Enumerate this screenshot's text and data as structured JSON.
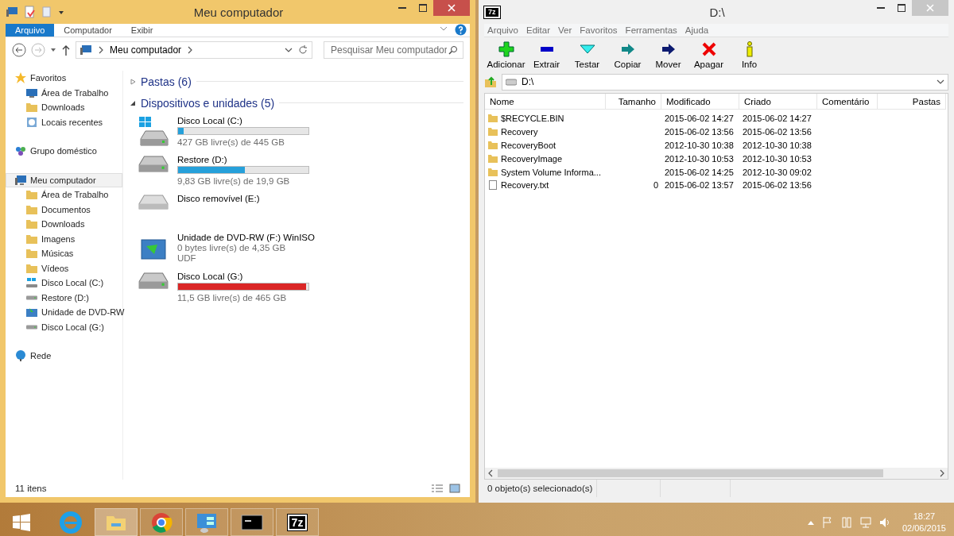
{
  "explorer": {
    "title": "Meu computador",
    "ribbon_tabs": [
      {
        "label": "Arquivo",
        "selected": true
      },
      {
        "label": "Computador",
        "selected": false
      },
      {
        "label": "Exibir",
        "selected": false
      }
    ],
    "address": "Meu computador",
    "search": {
      "placeholder": "Pesquisar Meu computador"
    },
    "sidebar": [
      {
        "label": "Favoritos",
        "kind": "star",
        "selected": false,
        "children": [
          {
            "label": "Área de Trabalho",
            "kind": "monitor",
            "selected": false
          },
          {
            "label": "Downloads",
            "kind": "folder",
            "selected": false
          },
          {
            "label": "Locais recentes",
            "kind": "recent",
            "selected": false
          }
        ]
      },
      {
        "label": "Grupo doméstico",
        "kind": "homegroup",
        "selected": false
      },
      {
        "label": "Meu computador",
        "kind": "computer",
        "selected": true,
        "children": [
          {
            "label": "Área de Trabalho",
            "kind": "folder",
            "selected": false
          },
          {
            "label": "Documentos",
            "kind": "folder",
            "selected": false
          },
          {
            "label": "Downloads",
            "kind": "folder",
            "selected": false
          },
          {
            "label": "Imagens",
            "kind": "folder",
            "selected": false
          },
          {
            "label": "Músicas",
            "kind": "folder",
            "selected": false
          },
          {
            "label": "Vídeos",
            "kind": "folder",
            "selected": false
          },
          {
            "label": "Disco Local (C:)",
            "kind": "windrive",
            "selected": false
          },
          {
            "label": "Restore (D:)",
            "kind": "drive",
            "selected": false
          },
          {
            "label": "Unidade de DVD-RW",
            "kind": "dvd",
            "selected": false
          },
          {
            "label": "Disco Local (G:)",
            "kind": "drive",
            "selected": false
          }
        ]
      },
      {
        "label": "Rede",
        "kind": "network",
        "selected": false
      }
    ],
    "sections": [
      {
        "title": "Pastas (6)",
        "expanded": false
      },
      {
        "title": "Dispositivos e unidades (5)",
        "expanded": true
      }
    ],
    "drives": [
      {
        "kind": "windisk",
        "name": "Disco Local (C:)",
        "level": 0.04,
        "color": "#26a0da",
        "details": [
          "427 GB livre(s) de 445 GB"
        ]
      },
      {
        "kind": "disk",
        "name": "Restore (D:)",
        "level": 0.51,
        "color": "#26a0da",
        "details": [
          "9,83 GB livre(s) de 19,9 GB"
        ]
      },
      {
        "kind": "removable",
        "name": "Disco removível (E:)"
      },
      {
        "kind": "dvd",
        "name": "Unidade de DVD-RW (F:) WinISO",
        "details": [
          "0 bytes livre(s) de 4,35 GB",
          "UDF"
        ]
      },
      {
        "kind": "disk",
        "name": "Disco Local (G:)",
        "level": 0.98,
        "color": "#da2626",
        "details": [
          "11,5 GB livre(s) de 465 GB"
        ]
      }
    ],
    "status": "11 itens"
  },
  "sevenzip": {
    "title": "D:\\",
    "logo": "7z",
    "menu": [
      "Arquivo",
      "Editar",
      "Ver",
      "Favoritos",
      "Ferramentas",
      "Ajuda"
    ],
    "tools": [
      {
        "kind": "add",
        "label": "Adicionar"
      },
      {
        "kind": "extract",
        "label": "Extrair"
      },
      {
        "kind": "test",
        "label": "Testar"
      },
      {
        "kind": "copy",
        "label": "Copiar"
      },
      {
        "kind": "move",
        "label": "Mover"
      },
      {
        "kind": "delete",
        "label": "Apagar"
      },
      {
        "kind": "info",
        "label": "Info"
      }
    ],
    "path": "D:\\",
    "columns": [
      "Nome",
      "Tamanho",
      "Modificado",
      "Criado",
      "Comentário",
      "Pastas"
    ],
    "rows": [
      {
        "kind": "folder",
        "name": "$RECYCLE.BIN",
        "modified": "2015-06-02 14:27",
        "created": "2015-06-02 14:27"
      },
      {
        "kind": "folder",
        "name": "Recovery",
        "modified": "2015-06-02 13:56",
        "created": "2015-06-02 13:56"
      },
      {
        "kind": "folder",
        "name": "RecoveryBoot",
        "modified": "2012-10-30 10:38",
        "created": "2012-10-30 10:38"
      },
      {
        "kind": "folder",
        "name": "RecoveryImage",
        "modified": "2012-10-30 10:53",
        "created": "2012-10-30 10:53"
      },
      {
        "kind": "folder",
        "name": "System Volume Informa...",
        "modified": "2015-06-02 14:25",
        "created": "2012-10-30 09:02"
      },
      {
        "kind": "file",
        "name": "Recovery.txt",
        "size": "0",
        "modified": "2015-06-02 13:57",
        "created": "2015-06-02 13:56"
      }
    ],
    "status": "0 objeto(s) selecionado(s)"
  },
  "taskbar": {
    "items": [
      {
        "kind": "ie",
        "running": false,
        "selected": false
      },
      {
        "kind": "explorer",
        "running": true,
        "selected": true
      },
      {
        "kind": "chrome",
        "running": true,
        "selected": false
      },
      {
        "kind": "control",
        "running": true,
        "selected": false
      },
      {
        "kind": "console",
        "running": true,
        "selected": false
      },
      {
        "kind": "sevenzip",
        "running": true,
        "selected": false,
        "logo": "7z"
      }
    ],
    "time": "18:27",
    "date": "02/06/2015"
  }
}
